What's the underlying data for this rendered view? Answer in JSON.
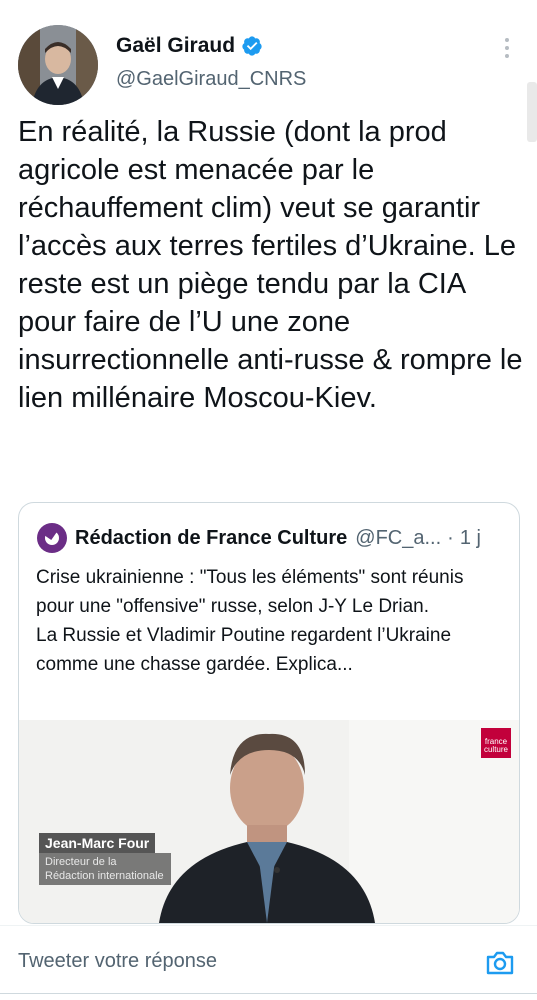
{
  "author": {
    "name": "Gaël Giraud",
    "handle": "@GaelGiraud_CNRS",
    "verified": true
  },
  "tweet": {
    "text": "En réalité, la Russie (dont la prod agricole est menacée par le réchauffement clim) veut se garantir l’accès aux terres fertiles d’Ukraine. Le reste est un piège tendu par la CIA pour faire de l’U une zone insurrectionnelle anti-russe & rompre le lien millénaire Moscou-Kiev."
  },
  "quote": {
    "name": "Rédaction de France Culture",
    "handle": "@FC_a...",
    "separator": "·",
    "time": "1 j",
    "line1": "Crise ukrainienne : \"Tous les éléments\" sont réunis pour une \"offensive\" russe, selon J-Y Le Drian.",
    "line2": "La Russie et Vladimir Poutine regardent l’Ukraine comme une chasse gardée. Explica...",
    "media": {
      "badge_line1": "france",
      "badge_line2": "culture",
      "caption_name": "Jean-Marc Four",
      "caption_role": "Directeur de la Rédaction internationale"
    }
  },
  "reply": {
    "placeholder": "Tweeter votre réponse"
  },
  "colors": {
    "verified_blue": "#1d9bf0",
    "secondary_text": "#536471",
    "fc_purple": "#6b2d86",
    "fc_red": "#c2003b"
  },
  "icons": {
    "verified": "verified-badge-icon",
    "more": "more-vertical-icon",
    "camera": "camera-icon"
  }
}
